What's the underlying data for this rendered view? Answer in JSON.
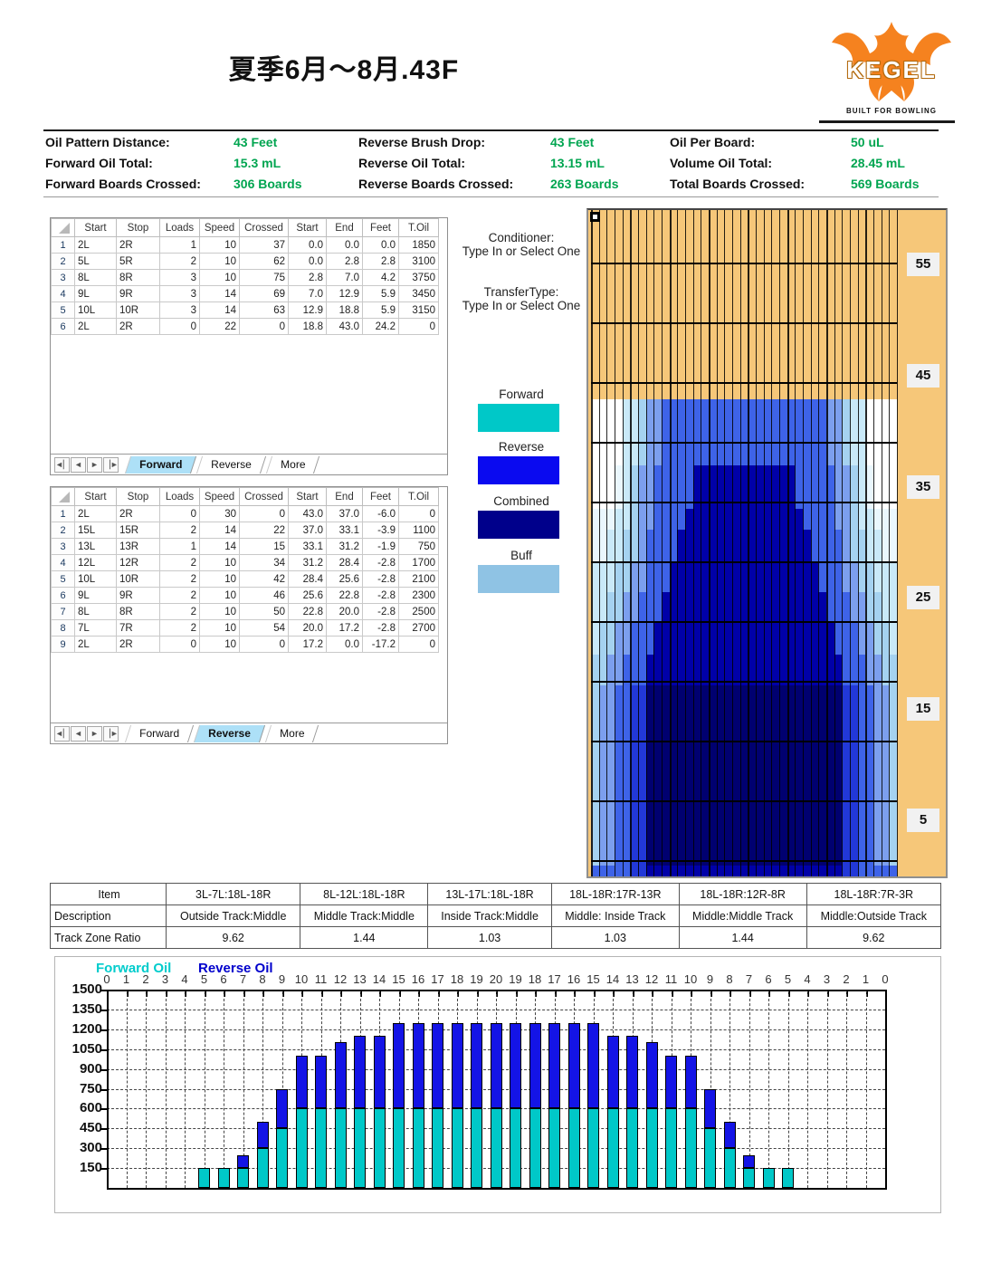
{
  "title": "夏季6月～8月.43F",
  "logo": {
    "brand": "KEGEL",
    "tagline": "BUILT FOR BOWLING"
  },
  "summary": {
    "rows": [
      [
        {
          "label": "Oil Pattern Distance:",
          "value": "43 Feet"
        },
        {
          "label": "Reverse Brush Drop:",
          "value": "43 Feet"
        },
        {
          "label": "Oil Per Board:",
          "value": "50 uL"
        }
      ],
      [
        {
          "label": "Forward Oil Total:",
          "value": "15.3 mL"
        },
        {
          "label": "Reverse Oil Total:",
          "value": "13.15 mL"
        },
        {
          "label": "Volume Oil Total:",
          "value": "28.45 mL"
        }
      ],
      [
        {
          "label": "Forward Boards Crossed:",
          "value": "306 Boards"
        },
        {
          "label": "Reverse Boards Crossed:",
          "value": "263 Boards"
        },
        {
          "label": "Total Boards Crossed:",
          "value": "569 Boards"
        }
      ]
    ],
    "value_color": "#00A550"
  },
  "tables": {
    "headers": [
      "Start",
      "Stop",
      "Loads",
      "Speed",
      "Crossed",
      "Start",
      "End",
      "Feet",
      "T.Oil"
    ],
    "tabs": [
      "Forward",
      "Reverse",
      "More"
    ],
    "forward": {
      "active_tab": "Forward",
      "rows": [
        [
          "2L",
          "2R",
          "1",
          "10",
          "37",
          "0.0",
          "0.0",
          "0.0",
          "1850"
        ],
        [
          "5L",
          "5R",
          "2",
          "10",
          "62",
          "0.0",
          "2.8",
          "2.8",
          "3100"
        ],
        [
          "8L",
          "8R",
          "3",
          "10",
          "75",
          "2.8",
          "7.0",
          "4.2",
          "3750"
        ],
        [
          "9L",
          "9R",
          "3",
          "14",
          "69",
          "7.0",
          "12.9",
          "5.9",
          "3450"
        ],
        [
          "10L",
          "10R",
          "3",
          "14",
          "63",
          "12.9",
          "18.8",
          "5.9",
          "3150"
        ],
        [
          "2L",
          "2R",
          "0",
          "22",
          "0",
          "18.8",
          "43.0",
          "24.2",
          "0"
        ]
      ]
    },
    "reverse": {
      "active_tab": "Reverse",
      "rows": [
        [
          "2L",
          "2R",
          "0",
          "30",
          "0",
          "43.0",
          "37.0",
          "-6.0",
          "0"
        ],
        [
          "15L",
          "15R",
          "2",
          "14",
          "22",
          "37.0",
          "33.1",
          "-3.9",
          "1100"
        ],
        [
          "13L",
          "13R",
          "1",
          "14",
          "15",
          "33.1",
          "31.2",
          "-1.9",
          "750"
        ],
        [
          "12L",
          "12R",
          "2",
          "10",
          "34",
          "31.2",
          "28.4",
          "-2.8",
          "1700"
        ],
        [
          "10L",
          "10R",
          "2",
          "10",
          "42",
          "28.4",
          "25.6",
          "-2.8",
          "2100"
        ],
        [
          "9L",
          "9R",
          "2",
          "10",
          "46",
          "25.6",
          "22.8",
          "-2.8",
          "2300"
        ],
        [
          "8L",
          "8R",
          "2",
          "10",
          "50",
          "22.8",
          "20.0",
          "-2.8",
          "2500"
        ],
        [
          "7L",
          "7R",
          "2",
          "10",
          "54",
          "20.0",
          "17.2",
          "-2.8",
          "2700"
        ],
        [
          "2L",
          "2R",
          "0",
          "10",
          "0",
          "17.2",
          "0.0",
          "-17.2",
          "0"
        ]
      ]
    }
  },
  "legend": {
    "conditioner_label": "Conditioner:",
    "conditioner_value": "Type In or Select One",
    "transfer_label": "TransferType:",
    "transfer_value": "Type In or Select One",
    "swatches": [
      {
        "label": "Forward",
        "color": "#00C8C8"
      },
      {
        "label": "Reverse",
        "color": "#0A0AF0"
      },
      {
        "label": "Combined",
        "color": "#00008B"
      },
      {
        "label": "Buff",
        "color": "#8FC3E4"
      }
    ]
  },
  "lane": {
    "background_color": "#F6C779",
    "distance_labels": [
      55,
      45,
      35,
      25,
      15,
      5
    ],
    "max_feet": 60,
    "oil_end_feet": 43,
    "palette": {
      "W": "#FFFFFF",
      "P1": "#EAF7FD",
      "P2": "#C9E9F8",
      "P3": "#A5D2F0",
      "L": "#7C9FEE",
      "M": "#3E63E8",
      "R": "#2238D8",
      "N": "#0000A8",
      "D": "#000070"
    },
    "bands": [
      {
        "top_ft": 43.0,
        "bot_ft": 37.0,
        "colors": [
          "W",
          "W",
          "W",
          "W",
          "P2",
          "P2",
          "P3",
          "L",
          "L",
          "M",
          "M",
          "M",
          "M",
          "M",
          "M",
          "M",
          "M",
          "M",
          "M",
          "M"
        ]
      },
      {
        "top_ft": 37.0,
        "bot_ft": 33.1,
        "colors": [
          "W",
          "W",
          "W",
          "P1",
          "P2",
          "P3",
          "L",
          "L",
          "M",
          "M",
          "M",
          "M",
          "M",
          "N",
          "N",
          "N",
          "N",
          "N",
          "N",
          "N"
        ]
      },
      {
        "top_ft": 33.1,
        "bot_ft": 31.2,
        "colors": [
          "P1",
          "P1",
          "P1",
          "P2",
          "P2",
          "P3",
          "L",
          "L",
          "M",
          "M",
          "M",
          "M",
          "N",
          "N",
          "N",
          "N",
          "N",
          "N",
          "N",
          "N"
        ]
      },
      {
        "top_ft": 31.2,
        "bot_ft": 28.4,
        "colors": [
          "P1",
          "P1",
          "P2",
          "P2",
          "P3",
          "P3",
          "L",
          "M",
          "M",
          "M",
          "M",
          "N",
          "N",
          "N",
          "N",
          "N",
          "N",
          "N",
          "N",
          "N"
        ]
      },
      {
        "top_ft": 28.4,
        "bot_ft": 25.6,
        "colors": [
          "P2",
          "P2",
          "P2",
          "P3",
          "P3",
          "L",
          "L",
          "M",
          "M",
          "M",
          "N",
          "N",
          "N",
          "N",
          "N",
          "N",
          "N",
          "N",
          "N",
          "N"
        ]
      },
      {
        "top_ft": 25.6,
        "bot_ft": 22.8,
        "colors": [
          "P2",
          "P2",
          "P3",
          "P3",
          "L",
          "L",
          "M",
          "M",
          "M",
          "N",
          "N",
          "N",
          "N",
          "N",
          "N",
          "N",
          "N",
          "N",
          "N",
          "N"
        ]
      },
      {
        "top_ft": 22.8,
        "bot_ft": 20.0,
        "colors": [
          "P2",
          "P3",
          "P3",
          "L",
          "L",
          "M",
          "M",
          "M",
          "N",
          "N",
          "N",
          "N",
          "N",
          "N",
          "N",
          "N",
          "N",
          "N",
          "N",
          "N"
        ]
      },
      {
        "top_ft": 20.0,
        "bot_ft": 17.2,
        "colors": [
          "P3",
          "P3",
          "L",
          "L",
          "M",
          "M",
          "M",
          "N",
          "N",
          "N",
          "N",
          "N",
          "N",
          "N",
          "N",
          "N",
          "N",
          "N",
          "N",
          "N"
        ]
      },
      {
        "top_ft": 17.2,
        "bot_ft": 1.0,
        "colors": [
          "P3",
          "L",
          "L",
          "M",
          "M",
          "R",
          "R",
          "D",
          "D",
          "D",
          "D",
          "D",
          "D",
          "D",
          "D",
          "D",
          "D",
          "D",
          "D",
          "D"
        ]
      },
      {
        "top_ft": 1.0,
        "bot_ft": 0.0,
        "colors": [
          "M",
          "M",
          "M",
          "M",
          "M",
          "R",
          "R",
          "N",
          "N",
          "N",
          "N",
          "N",
          "N",
          "N",
          "N",
          "N",
          "N",
          "N",
          "N",
          "N"
        ]
      }
    ]
  },
  "ratio_table": {
    "row_headers": [
      "Item",
      "Description",
      "Track Zone Ratio"
    ],
    "columns": [
      {
        "item": "3L-7L:18L-18R",
        "description": "Outside Track:Middle",
        "ratio": "9.62"
      },
      {
        "item": "8L-12L:18L-18R",
        "description": "Middle Track:Middle",
        "ratio": "1.44"
      },
      {
        "item": "13L-17L:18L-18R",
        "description": "Inside Track:Middle",
        "ratio": "1.03"
      },
      {
        "item": "18L-18R:17R-13R",
        "description": "Middle: Inside Track",
        "ratio": "1.03"
      },
      {
        "item": "18L-18R:12R-8R",
        "description": "Middle:Middle Track",
        "ratio": "1.44"
      },
      {
        "item": "18L-18R:7R-3R",
        "description": "Middle:Outside Track",
        "ratio": "9.62"
      }
    ]
  },
  "chart_data": {
    "type": "bar",
    "stacked": true,
    "x_labels": [
      "0",
      "1",
      "2",
      "3",
      "4",
      "5",
      "6",
      "7",
      "8",
      "9",
      "10",
      "11",
      "12",
      "13",
      "14",
      "15",
      "16",
      "17",
      "18",
      "19",
      "20",
      "19",
      "18",
      "17",
      "16",
      "15",
      "14",
      "13",
      "12",
      "11",
      "10",
      "9",
      "8",
      "7",
      "6",
      "5",
      "4",
      "3",
      "2",
      "1",
      "0"
    ],
    "series": [
      {
        "name": "Forward Oil",
        "color": "#00C8C8",
        "values": [
          0,
          0,
          0,
          0,
          0,
          150,
          150,
          150,
          300,
          450,
          600,
          600,
          600,
          600,
          600,
          600,
          600,
          600,
          600,
          600,
          600,
          600,
          600,
          600,
          600,
          600,
          600,
          600,
          600,
          600,
          600,
          450,
          300,
          150,
          150,
          150,
          0,
          0,
          0,
          0,
          0
        ]
      },
      {
        "name": "Reverse Oil",
        "color": "#1414E6",
        "values": [
          0,
          0,
          0,
          0,
          0,
          0,
          0,
          100,
          200,
          300,
          400,
          400,
          500,
          550,
          550,
          650,
          650,
          650,
          650,
          650,
          650,
          650,
          650,
          650,
          650,
          650,
          550,
          550,
          500,
          400,
          400,
          300,
          200,
          100,
          0,
          0,
          0,
          0,
          0,
          0,
          0
        ]
      }
    ],
    "ylim": [
      0,
      1500
    ],
    "yticks": [
      150,
      300,
      450,
      600,
      750,
      900,
      1050,
      1200,
      1350,
      1500
    ],
    "grid": true,
    "legend_position": "top-left"
  }
}
